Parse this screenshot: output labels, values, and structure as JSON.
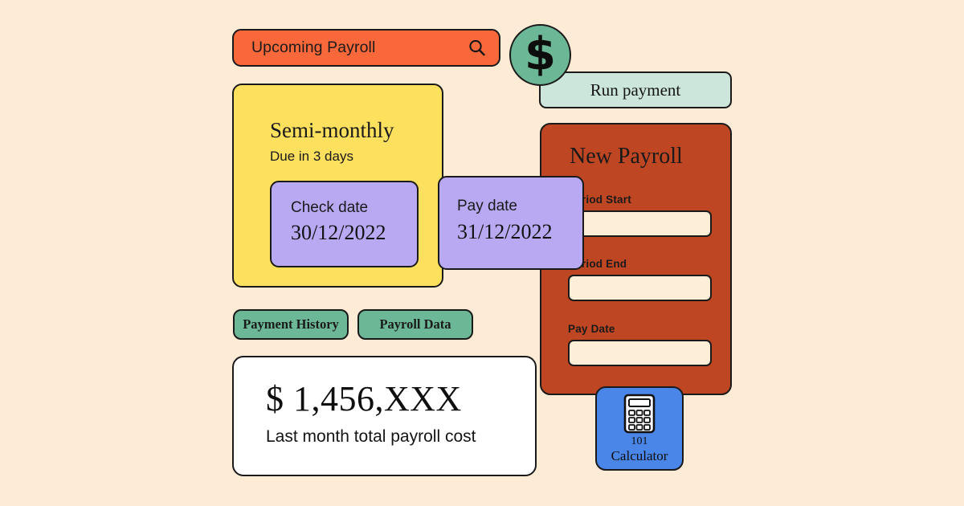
{
  "theme": {
    "background": "#fdebd6",
    "search_bar": "#f9683a",
    "yellow_card": "#fce05e",
    "purple_card": "#b9a8f2",
    "rust_panel": "#be4622",
    "green_pill": "#6cb795",
    "mint_bar": "#cce6dc",
    "calculator_tile": "#4a86e8",
    "white_card": "#ffffff",
    "outline": "#1a1a1a"
  },
  "search": {
    "value": "Upcoming Payroll",
    "icon": "search-icon"
  },
  "run_payment": {
    "label": "Run payment",
    "badge_glyph": "$",
    "badge_icon": "dollar-sign-icon"
  },
  "upcoming": {
    "title": "Semi-monthly",
    "due": "Due in 3 days",
    "check_date": {
      "label": "Check date",
      "value": "30/12/2022"
    },
    "pay_date": {
      "label": "Pay date",
      "value": "31/12/2022"
    }
  },
  "pills": [
    {
      "label": "Payment History"
    },
    {
      "label": "Payroll Data"
    }
  ],
  "total": {
    "amount": "$ 1,456,XXX",
    "caption": "Last month total payroll cost"
  },
  "new_payroll": {
    "title": "New Payroll",
    "fields": [
      {
        "label": "Period Start",
        "value": ""
      },
      {
        "label": "Period End",
        "value": ""
      },
      {
        "label": "Pay Date",
        "value": ""
      }
    ]
  },
  "calculator": {
    "icon": "calculator-icon",
    "number": "101",
    "label": "Calculator"
  }
}
